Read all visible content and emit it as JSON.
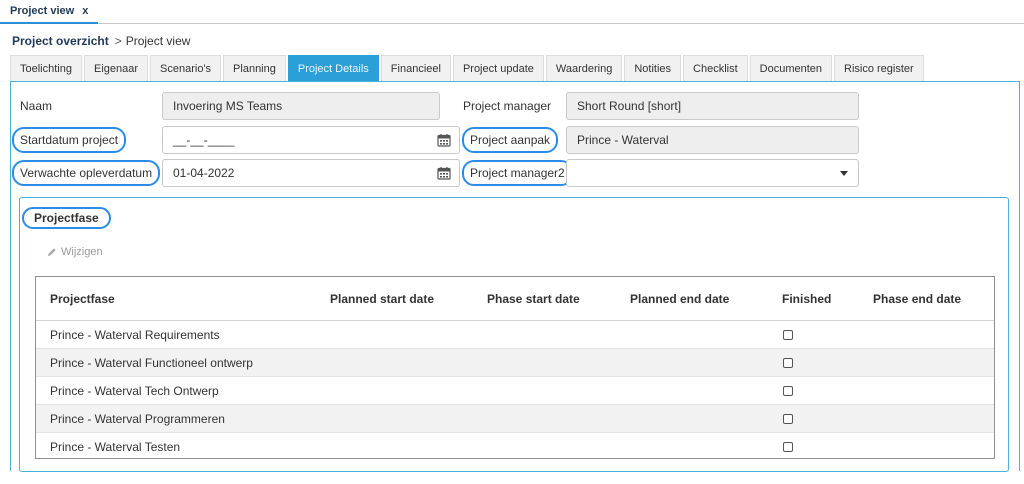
{
  "window": {
    "tab_title": "Project view",
    "close_glyph": "x"
  },
  "breadcrumb": {
    "parent": "Project overzicht",
    "separator": ">",
    "current": "Project view"
  },
  "tabs": [
    {
      "label": "Toelichting",
      "active": false
    },
    {
      "label": "Eigenaar",
      "active": false
    },
    {
      "label": "Scenario's",
      "active": false
    },
    {
      "label": "Planning",
      "active": false
    },
    {
      "label": "Project Details",
      "active": true
    },
    {
      "label": "Financieel",
      "active": false
    },
    {
      "label": "Project update",
      "active": false
    },
    {
      "label": "Waardering",
      "active": false
    },
    {
      "label": "Notities",
      "active": false
    },
    {
      "label": "Checklist",
      "active": false
    },
    {
      "label": "Documenten",
      "active": false
    },
    {
      "label": "Risico register",
      "active": false
    }
  ],
  "form": {
    "naam_label": "Naam",
    "naam_value": "Invoering MS Teams",
    "project_manager_label": "Project manager",
    "project_manager_value": "Short Round [short]",
    "startdatum_label": "Startdatum project",
    "startdatum_value": "__-__-____",
    "project_aanpak_label": "Project aanpak",
    "project_aanpak_value": "Prince - Waterval",
    "verwachte_label": "Verwachte opleverdatum",
    "verwachte_value": "01-04-2022",
    "project_manager2_label": "Project manager2",
    "project_manager2_value": ""
  },
  "projectfase": {
    "title": "Projectfase",
    "edit_label": "Wijzigen",
    "columns": [
      "Projectfase",
      "Planned start date",
      "Phase start date",
      "Planned end date",
      "Finished",
      "Phase end date"
    ],
    "rows": [
      {
        "name": "Prince - Waterval Requirements",
        "finished": false
      },
      {
        "name": "Prince - Waterval Functioneel ontwerp",
        "finished": false
      },
      {
        "name": "Prince - Waterval Tech Ontwerp",
        "finished": false
      },
      {
        "name": "Prince - Waterval Programmeren",
        "finished": false
      },
      {
        "name": "Prince - Waterval Testen",
        "finished": false
      }
    ]
  },
  "icons": {
    "calendar": "calendar-icon",
    "dropdown": "chevron-down-icon",
    "edit": "pencil-icon"
  },
  "colors": {
    "accent": "#2a9fd8",
    "highlight_circle": "#2b8ce8",
    "panel_border": "#4ab1dc"
  }
}
